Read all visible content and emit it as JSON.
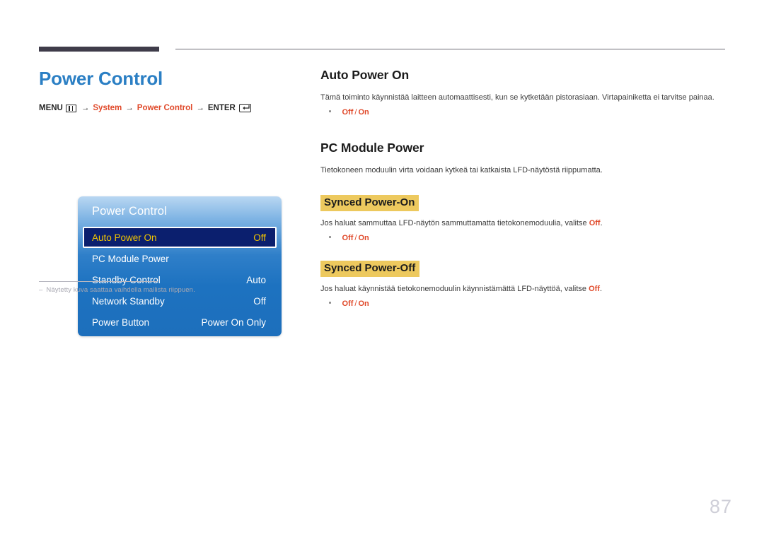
{
  "header": {
    "rule_thick": "decorative-thick-bar",
    "rule_thin": "decorative-thin-rule"
  },
  "left": {
    "page_title": "Power Control",
    "breadcrumb": {
      "menu_label": "MENU",
      "menu_icon": "menu-grid-icon",
      "arrow": "→",
      "step1": "System",
      "step2": "Power Control",
      "enter_label": "ENTER",
      "enter_icon": "enter-key-icon"
    },
    "osd": {
      "title": "Power Control",
      "rows": [
        {
          "label": "Auto Power On",
          "value": "Off",
          "selected": true
        },
        {
          "label": "PC Module Power",
          "value": "",
          "selected": false
        },
        {
          "label": "Standby Control",
          "value": "Auto",
          "selected": false
        },
        {
          "label": "Network Standby",
          "value": "Off",
          "selected": false
        },
        {
          "label": "Power Button",
          "value": "Power On Only",
          "selected": false
        }
      ]
    },
    "footnote": {
      "dash": "–",
      "text": "Näytetty kuva saattaa vaihdella mallista riippuen."
    }
  },
  "right": {
    "auto_power_on": {
      "heading": "Auto Power On",
      "body": "Tämä toiminto käynnistää laitteen automaattisesti, kun se kytketään pistorasiaan. Virtapainiketta ei tarvitse painaa.",
      "option_off": "Off",
      "option_sep": "/",
      "option_on": "On"
    },
    "pc_module_power": {
      "heading": "PC Module Power",
      "body": "Tietokoneen moduulin virta voidaan kytkeä tai katkaista LFD-näytöstä riippumatta."
    },
    "synced_power_on": {
      "heading": "Synced Power-On",
      "body_before": "Jos haluat sammuttaa LFD-näytön sammuttamatta tietokonemoduulia, valitse ",
      "body_em": "Off",
      "body_after": ".",
      "option_off": "Off",
      "option_sep": "/",
      "option_on": "On"
    },
    "synced_power_off": {
      "heading": "Synced Power-Off",
      "body_before": "Jos haluat käynnistää tietokonemoduulin käynnistämättä LFD-näyttöä, valitse ",
      "body_em": "Off",
      "body_after": ".",
      "option_off": "Off",
      "option_sep": "/",
      "option_on": "On"
    }
  },
  "page_number": "87",
  "colors": {
    "title_blue": "#2b7fc4",
    "accent_orange": "#e0492a",
    "highlight_yellow": "#edc95e",
    "osd_blue": "#1d72c0",
    "osd_selected_navy": "#0b1f6e",
    "osd_selected_gold": "#f2c500",
    "rule_dark": "#3f3c4a"
  }
}
